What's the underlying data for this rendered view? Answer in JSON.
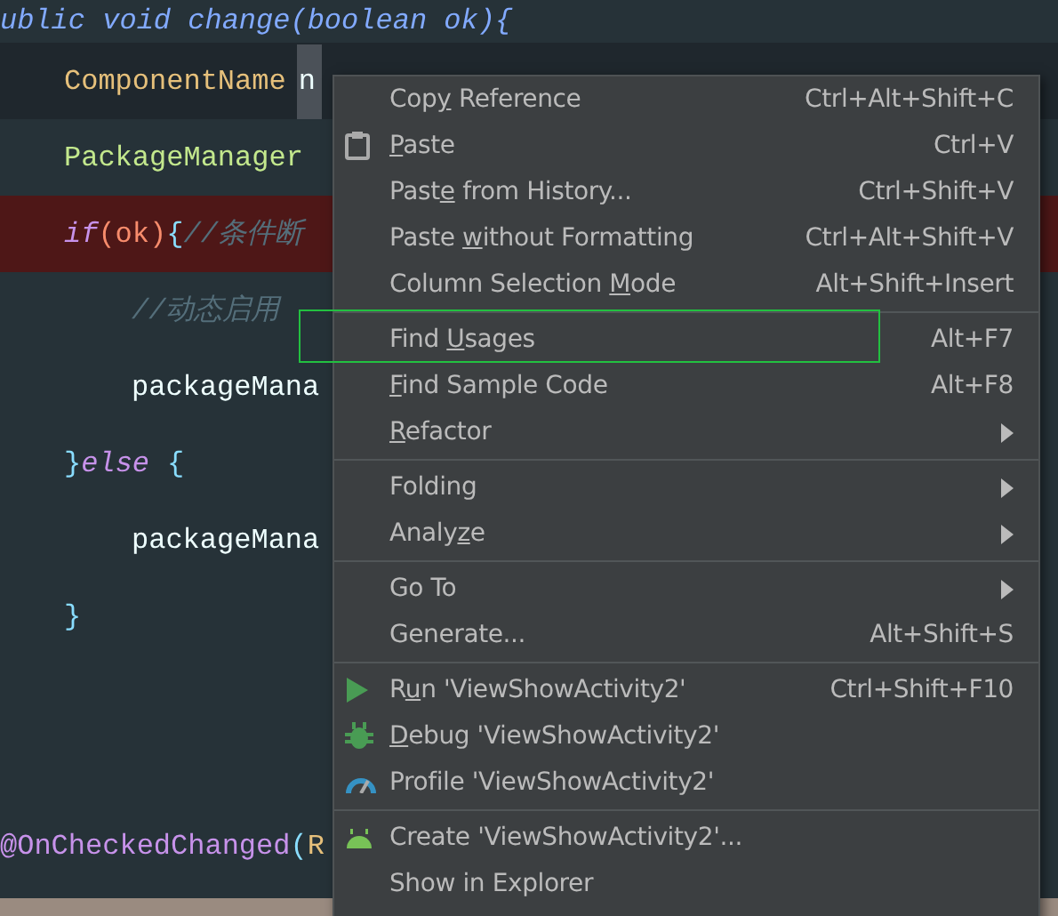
{
  "editor": {
    "lines": [
      {
        "kind": "plain",
        "tokens": [
          {
            "text": "ublic void change(boolean ok){",
            "kind": "cut"
          }
        ]
      },
      {
        "kind": "current",
        "tokens": [
          {
            "text": "ComponentName",
            "kind": "type"
          },
          {
            "text": "n",
            "kind": "selected"
          }
        ]
      },
      {
        "kind": "plain",
        "tokens": [
          {
            "text": "PackageManager",
            "kind": "type2"
          }
        ]
      },
      {
        "kind": "breakpoint",
        "tokens": [
          {
            "text": "if",
            "kind": "keyword"
          },
          {
            "text": "(ok)",
            "kind": "param"
          },
          {
            "text": "{",
            "kind": "brace"
          },
          {
            "text": "//条件断",
            "kind": "comment"
          }
        ]
      },
      {
        "kind": "plain",
        "tokens": [
          {
            "text": "//动态启用",
            "kind": "comment"
          }
        ]
      },
      {
        "kind": "plain",
        "tokens": [
          {
            "text": "packageMana",
            "kind": "plain"
          }
        ]
      },
      {
        "kind": "plain",
        "tokens": [
          {
            "text": "}",
            "kind": "brace"
          },
          {
            "text": "else",
            "kind": "keyword"
          },
          {
            "text": "{",
            "kind": "spaced-brace"
          }
        ]
      },
      {
        "kind": "plain",
        "tokens": [
          {
            "text": "packageMana",
            "kind": "plain"
          }
        ]
      },
      {
        "kind": "plain",
        "tokens": [
          {
            "text": "}",
            "kind": "brace"
          }
        ]
      },
      {
        "kind": "plain"
      },
      {
        "kind": "plain"
      },
      {
        "kind": "plain",
        "tokens": [
          {
            "text": "@OnCheckedChanged",
            "kind": "annotation"
          },
          {
            "text": "(",
            "kind": "brace"
          },
          {
            "text": "R",
            "kind": "type"
          }
        ]
      }
    ]
  },
  "context_menu": {
    "groups": [
      [
        {
          "kind": "plain",
          "label": [
            {
              "text": "Cop",
              "mnemonic": false
            },
            {
              "text": "y",
              "mnemonic": true
            },
            {
              "text": " Reference",
              "mnemonic": false
            }
          ],
          "shortcut": "Ctrl+Alt+Shift+C",
          "submenu": false
        },
        {
          "kind": "paste",
          "label": [
            {
              "text": "P",
              "mnemonic": true
            },
            {
              "text": "aste",
              "mnemonic": false
            }
          ],
          "shortcut": "Ctrl+V",
          "submenu": false
        },
        {
          "kind": "plain",
          "label": [
            {
              "text": "Past",
              "mnemonic": false
            },
            {
              "text": "e",
              "mnemonic": true
            },
            {
              "text": " from History...",
              "mnemonic": false
            }
          ],
          "shortcut": "Ctrl+Shift+V",
          "submenu": false
        },
        {
          "kind": "plain",
          "label": [
            {
              "text": "Paste ",
              "mnemonic": false
            },
            {
              "text": "w",
              "mnemonic": true
            },
            {
              "text": "ithout Formatting",
              "mnemonic": false
            }
          ],
          "shortcut": "Ctrl+Alt+Shift+V",
          "submenu": false
        },
        {
          "kind": "plain",
          "label": [
            {
              "text": "Column Selection ",
              "mnemonic": false
            },
            {
              "text": "M",
              "mnemonic": true
            },
            {
              "text": "ode",
              "mnemonic": false
            }
          ],
          "shortcut": "Alt+Shift+Insert",
          "submenu": false
        }
      ],
      [
        {
          "kind": "plain",
          "label": [
            {
              "text": "Find ",
              "mnemonic": false
            },
            {
              "text": "U",
              "mnemonic": true
            },
            {
              "text": "sages",
              "mnemonic": false
            }
          ],
          "shortcut": "Alt+F7",
          "submenu": false
        },
        {
          "kind": "plain",
          "label": [
            {
              "text": "F",
              "mnemonic": true
            },
            {
              "text": "ind Sample Code",
              "mnemonic": false
            }
          ],
          "shortcut": "Alt+F8",
          "submenu": false
        },
        {
          "kind": "plain",
          "label": [
            {
              "text": "R",
              "mnemonic": true
            },
            {
              "text": "efactor",
              "mnemonic": false
            }
          ],
          "submenu": true
        }
      ],
      [
        {
          "kind": "plain",
          "label": [
            {
              "text": "Folding",
              "mnemonic": false
            }
          ],
          "submenu": true
        },
        {
          "kind": "plain",
          "label": [
            {
              "text": "Analy",
              "mnemonic": false
            },
            {
              "text": "z",
              "mnemonic": true
            },
            {
              "text": "e",
              "mnemonic": false
            }
          ],
          "submenu": true
        }
      ],
      [
        {
          "kind": "plain",
          "label": [
            {
              "text": "Go To",
              "mnemonic": false
            }
          ],
          "submenu": true
        },
        {
          "kind": "plain",
          "label": [
            {
              "text": "Generate...",
              "mnemonic": false
            }
          ],
          "shortcut": "Alt+Shift+S",
          "submenu": false
        }
      ],
      [
        {
          "kind": "run",
          "label": [
            {
              "text": "R",
              "mnemonic": false
            },
            {
              "text": "u",
              "mnemonic": true
            },
            {
              "text": "n 'ViewShowActivity2'",
              "mnemonic": false
            }
          ],
          "shortcut": "Ctrl+Shift+F10",
          "submenu": false
        },
        {
          "kind": "debug",
          "label": [
            {
              "text": "D",
              "mnemonic": true
            },
            {
              "text": "ebug 'ViewShowActivity2'",
              "mnemonic": false
            }
          ],
          "submenu": false
        },
        {
          "kind": "profile",
          "label": [
            {
              "text": "Profile 'ViewShowActivity2'",
              "mnemonic": false
            }
          ],
          "submenu": false
        }
      ],
      [
        {
          "kind": "create",
          "label": [
            {
              "text": "Create 'ViewShowActivity2'...",
              "mnemonic": false
            }
          ],
          "submenu": false
        },
        {
          "kind": "plain",
          "label": [
            {
              "text": "Show in Explorer",
              "mnemonic": false
            }
          ],
          "submenu": false
        }
      ]
    ]
  }
}
